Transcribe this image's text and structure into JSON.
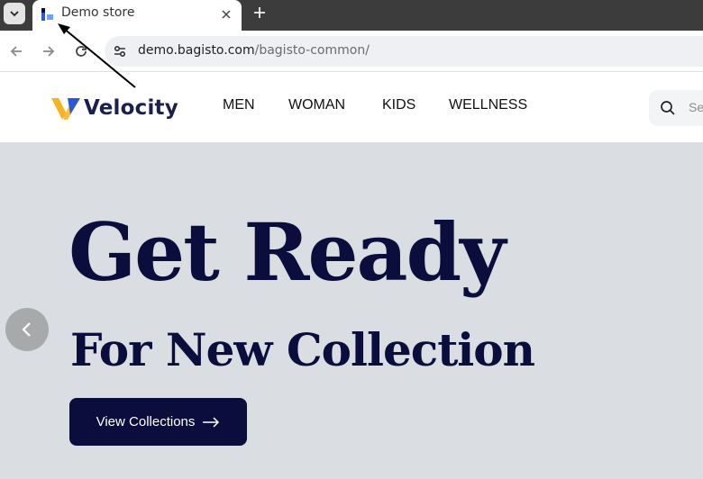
{
  "browser": {
    "tab_title": "Demo store",
    "url_domain": "demo.bagisto.com",
    "url_path": "/bagisto-common/"
  },
  "header": {
    "logo_text": "Velocity",
    "nav": [
      "MEN",
      "WOMAN",
      "KIDS",
      "WELLNESS"
    ],
    "search_placeholder": "Se"
  },
  "hero": {
    "title": "Get Ready",
    "subtitle": "For New Collection",
    "cta_label": "View Collections"
  },
  "colors": {
    "brand_navy": "#0b0e3c",
    "hero_bg": "#dadde1",
    "logo_yellow": "#f5b324",
    "logo_blue": "#2b59d6"
  }
}
